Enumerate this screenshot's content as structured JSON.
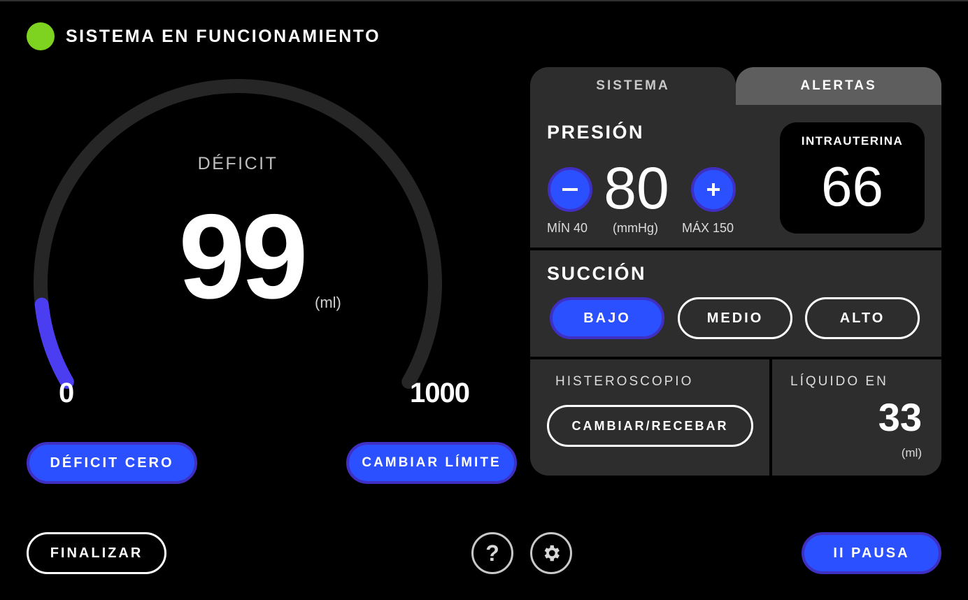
{
  "status": {
    "text": "SISTEMA EN FUNCIONAMIENTO",
    "color": "#7ed321"
  },
  "deficit": {
    "label": "DÉFICIT",
    "value": "99",
    "unit": "(ml)",
    "min": "0",
    "max": "1000",
    "fill_fraction": 0.099,
    "track_color": "#262626",
    "fill_color": "#4b3ef0"
  },
  "actions": {
    "zero_label": "DÉFICIT CERO",
    "limit_label": "CAMBIAR LÍMITE",
    "finish_label": "FINALIZAR",
    "pause_label": "II PAUSA",
    "help_label": "?"
  },
  "tabs": [
    {
      "label": "SISTEMA",
      "active": true
    },
    {
      "label": "ALERTAS",
      "active": false
    }
  ],
  "pressure": {
    "title": "PRESIÓN",
    "value": "80",
    "unit": "(mmHg)",
    "min_label": "MÍN 40",
    "max_label": "MÁX 150",
    "intra_label": "INTRAUTERINA",
    "intra_value": "66"
  },
  "suction": {
    "title": "SUCCIÓN",
    "options": [
      "BAJO",
      "MEDIO",
      "ALTO"
    ],
    "selected": "BAJO"
  },
  "hysteroscope": {
    "title": "HISTEROSCOPIO",
    "button_label": "CAMBIAR/RECEBAR"
  },
  "fluid": {
    "title": "LÍQUIDO EN",
    "value": "33",
    "unit": "(ml)"
  },
  "colors": {
    "accent": "#2a50ff",
    "accent_border": "#3f2fc2",
    "panel": "#2d2d2d",
    "tab_inactive": "#5e5e5e"
  }
}
